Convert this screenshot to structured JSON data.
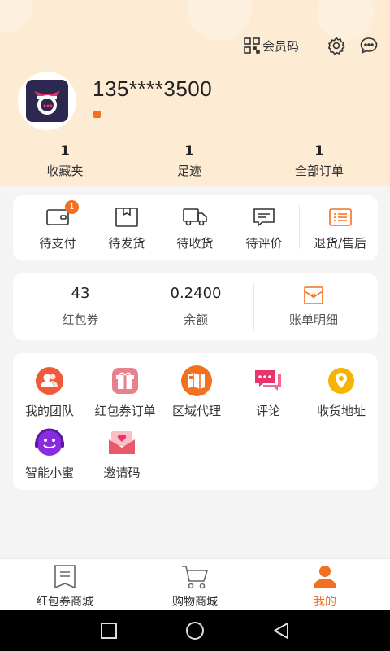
{
  "header": {
    "member_code_label": "会员码",
    "phone": "135****3500"
  },
  "stats": [
    {
      "value": "1",
      "label": "收藏夹"
    },
    {
      "value": "1",
      "label": "足迹"
    },
    {
      "value": "1",
      "label": "全部订单"
    }
  ],
  "orders": {
    "items": [
      {
        "label": "待支付",
        "icon": "wallet-icon",
        "badge": "1"
      },
      {
        "label": "待发货",
        "icon": "package-icon"
      },
      {
        "label": "待收货",
        "icon": "truck-icon"
      },
      {
        "label": "待评价",
        "icon": "comment-icon"
      },
      {
        "label": "退货/售后",
        "icon": "list-icon"
      }
    ]
  },
  "wallet": {
    "coupons_value": "43",
    "coupons_label": "红包券",
    "balance_value": "0.2400",
    "balance_label": "余额",
    "bill_label": "账单明细"
  },
  "services": [
    {
      "label": "我的团队",
      "icon": "team-icon",
      "color": "#f05a3a"
    },
    {
      "label": "红包券订单",
      "icon": "gift-icon",
      "color": "#e86a7a"
    },
    {
      "label": "区域代理",
      "icon": "map-icon",
      "color": "#f37021"
    },
    {
      "label": "评论",
      "icon": "message-icon",
      "color": "#e8336b"
    },
    {
      "label": "收货地址",
      "icon": "location-icon",
      "color": "#f5b400"
    },
    {
      "label": "智能小蜜",
      "icon": "assistant-icon",
      "color": "#8a2be2"
    },
    {
      "label": "邀请码",
      "icon": "invite-icon",
      "color": "#e85a6a"
    }
  ],
  "tabbar": [
    {
      "label": "红包券商城",
      "icon": "coupon-mall-icon"
    },
    {
      "label": "购物商城",
      "icon": "cart-icon"
    },
    {
      "label": "我的",
      "icon": "profile-icon",
      "active": true
    }
  ],
  "colors": {
    "accent": "#f37021",
    "header_bg": "#fdebd4"
  }
}
